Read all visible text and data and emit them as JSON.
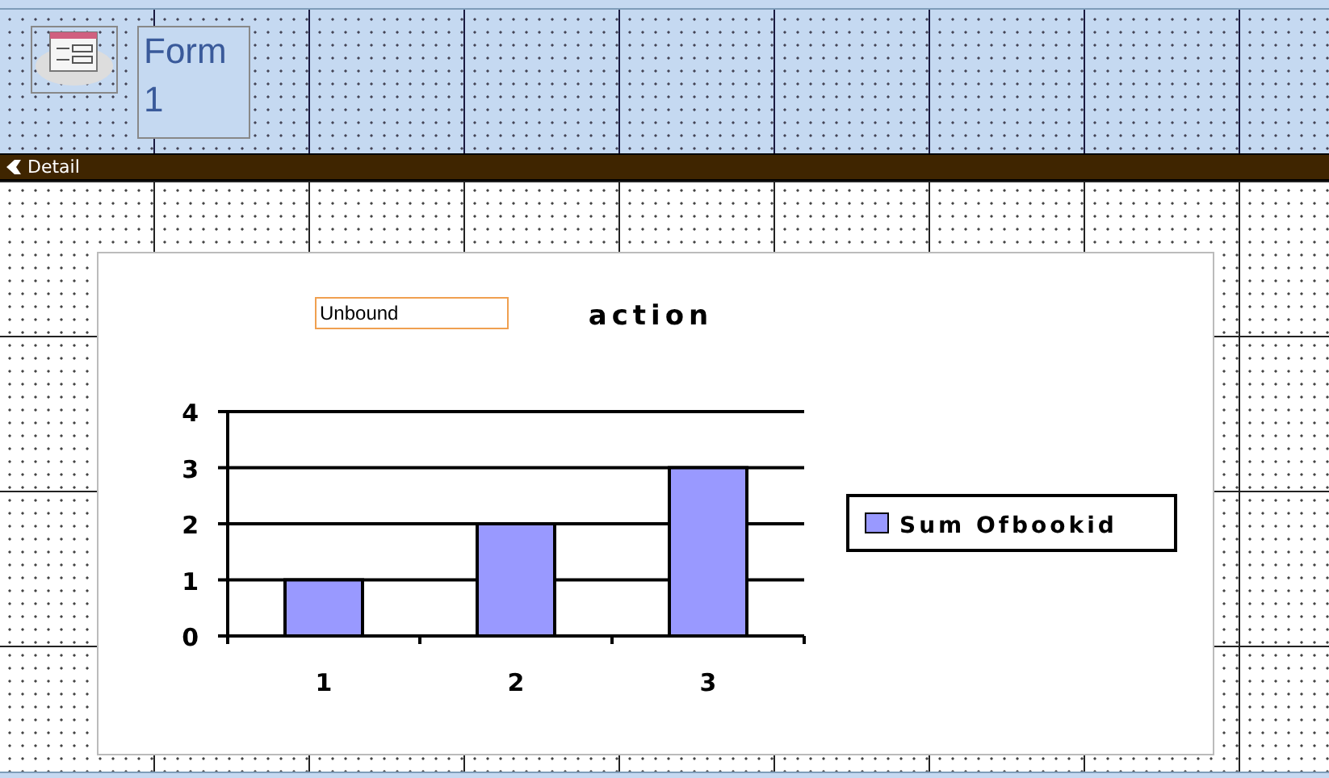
{
  "form_header": {
    "title": "Form 1"
  },
  "detail_bar": {
    "label": "Detail"
  },
  "detail": {
    "unbound_field": {
      "value": "Unbound"
    },
    "chart": {
      "chart_data": {
        "type": "bar",
        "title": "action",
        "categories": [
          "1",
          "2",
          "3"
        ],
        "series": [
          {
            "name": "Sum Ofbookid",
            "color": "#9999ff",
            "values": [
              1,
              2,
              3
            ]
          }
        ],
        "ylim": [
          0,
          4
        ],
        "grid": true,
        "yticks": [
          0,
          1,
          2,
          3,
          4
        ]
      }
    }
  }
}
